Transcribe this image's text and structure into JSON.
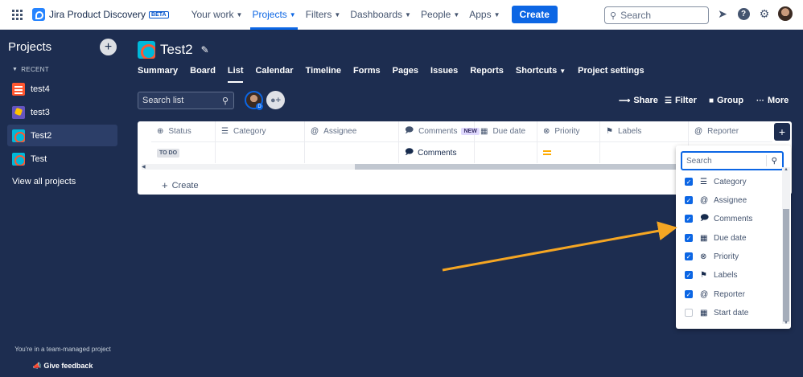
{
  "topnav": {
    "brand": "Jira Product Discovery",
    "beta": "BETA",
    "items": [
      {
        "label": "Your work"
      },
      {
        "label": "Projects"
      },
      {
        "label": "Filters"
      },
      {
        "label": "Dashboards"
      },
      {
        "label": "People"
      },
      {
        "label": "Apps"
      }
    ],
    "active_item": "Projects",
    "create_label": "Create",
    "search_placeholder": "Search"
  },
  "sidebar": {
    "title": "Projects",
    "recent_label": "RECENT",
    "items": [
      {
        "label": "test4",
        "icon": "project-icon-test4"
      },
      {
        "label": "test3",
        "icon": "project-icon-test3"
      },
      {
        "label": "Test2",
        "icon": "project-icon-test2"
      },
      {
        "label": "Test",
        "icon": "project-icon-test"
      }
    ],
    "active_item": "Test2",
    "view_all": "View all projects",
    "footer_text": "You're in a team-managed project",
    "feedback": "Give feedback"
  },
  "project": {
    "title": "Test2",
    "tabs": [
      {
        "label": "Summary"
      },
      {
        "label": "Board"
      },
      {
        "label": "List"
      },
      {
        "label": "Calendar"
      },
      {
        "label": "Timeline"
      },
      {
        "label": "Forms"
      },
      {
        "label": "Pages"
      },
      {
        "label": "Issues"
      },
      {
        "label": "Reports"
      },
      {
        "label": "Shortcuts"
      },
      {
        "label": "Project settings"
      }
    ],
    "active_tab": "List"
  },
  "toolbar": {
    "search_placeholder": "Search list",
    "avatar_badge": "D",
    "share": "Share",
    "filter": "Filter",
    "group": "Group",
    "more": "More"
  },
  "table": {
    "columns": [
      {
        "label": "Status",
        "icon": "status-icon"
      },
      {
        "label": "Category",
        "icon": "category-icon"
      },
      {
        "label": "Assignee",
        "icon": "at-icon"
      },
      {
        "label": "Comments",
        "icon": "comments-icon",
        "badge": "NEW"
      },
      {
        "label": "Due date",
        "icon": "calendar-icon"
      },
      {
        "label": "Priority",
        "icon": "priority-icon"
      },
      {
        "label": "Labels",
        "icon": "tag-icon"
      },
      {
        "label": "Reporter",
        "icon": "at-icon"
      }
    ],
    "row": {
      "status": "TO DO",
      "comments": "Comments",
      "priority": "medium"
    },
    "create_label": "Create"
  },
  "field_dropdown": {
    "search_placeholder": "Search",
    "items": [
      {
        "label": "Category",
        "checked": true,
        "icon": "category-icon"
      },
      {
        "label": "Assignee",
        "checked": true,
        "icon": "at-icon"
      },
      {
        "label": "Comments",
        "checked": true,
        "icon": "comments-icon"
      },
      {
        "label": "Due date",
        "checked": true,
        "icon": "calendar-icon"
      },
      {
        "label": "Priority",
        "checked": true,
        "icon": "priority-icon"
      },
      {
        "label": "Labels",
        "checked": true,
        "icon": "tag-icon"
      },
      {
        "label": "Reporter",
        "checked": true,
        "icon": "at-icon"
      },
      {
        "label": "Start date",
        "checked": false,
        "icon": "calendar-icon"
      }
    ]
  },
  "colors": {
    "nav_bg": "#1d2d50",
    "accent": "#0c66e4",
    "annotation_arrow": "#f5a623"
  }
}
